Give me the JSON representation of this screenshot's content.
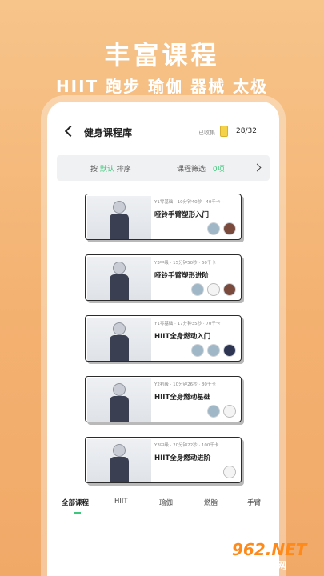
{
  "promo": {
    "title": "丰富课程",
    "subtitle": "HIIT 跑步 瑜伽 器械 太极"
  },
  "header": {
    "title": "健身课程库",
    "collected_label": "已收集",
    "collected_count": "28/32"
  },
  "filters": {
    "sort_prefix": "按",
    "sort_value": "默认",
    "sort_suffix": "排序",
    "filter_label": "课程筛选",
    "filter_count": "0项"
  },
  "courses": [
    {
      "meta": "Y1零基础 · 10分钟40秒 · 40千卡",
      "title": "哑铃手臂塑形入门",
      "avatars": [
        "blue",
        "brown"
      ]
    },
    {
      "meta": "Y3中级 · 15分钟50秒 · 60千卡",
      "title": "哑铃手臂塑形进阶",
      "avatars": [
        "blue",
        "white",
        "brown"
      ]
    },
    {
      "meta": "Y1零基础 · 17分钟35秒 · 70千卡",
      "title": "HIIT全身燃动入门",
      "avatars": [
        "blue",
        "blue",
        "dark"
      ]
    },
    {
      "meta": "Y2初级 · 10分钟26秒 · 80千卡",
      "title": "HIIT全身燃动基础",
      "avatars": [
        "blue",
        "white"
      ]
    },
    {
      "meta": "Y3中级 · 20分钟22秒 · 100千卡",
      "title": "HIIT全身燃动进阶",
      "avatars": [
        "white"
      ]
    }
  ],
  "tabs": [
    "全部课程",
    "HIIT",
    "瑜伽",
    "燃脂",
    "手臂"
  ],
  "watermark": {
    "number": "962.NET",
    "site": "乐游网"
  }
}
